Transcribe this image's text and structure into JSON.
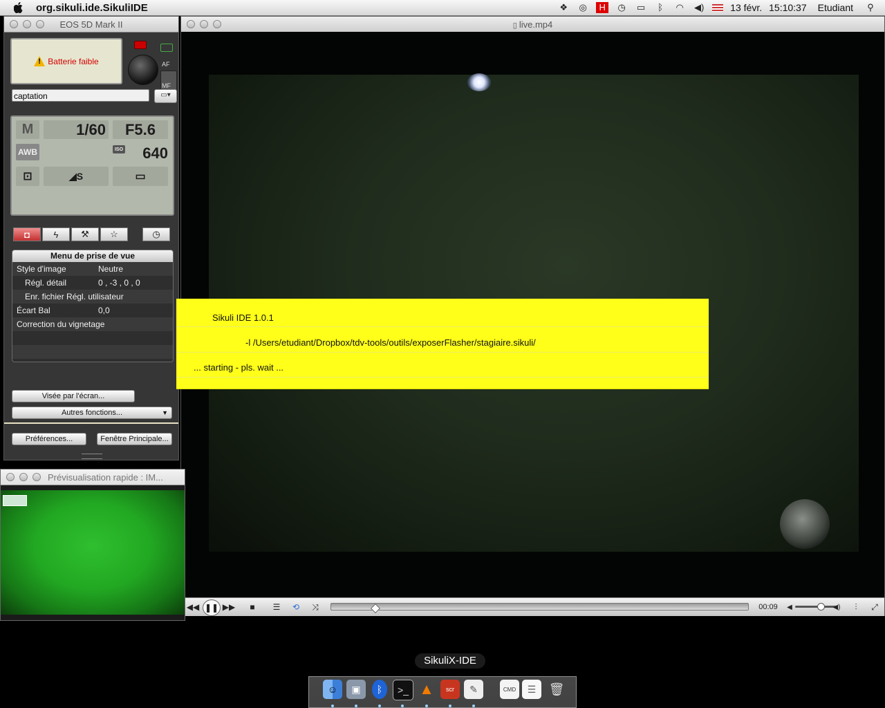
{
  "menubar": {
    "app_name": "org.sikuli.ide.SikuliIDE",
    "date": "13 févr.",
    "time": "15:10:37",
    "user": "Etudiant",
    "icons": [
      "dropbox-icon",
      "cc-icon",
      "flag-icon",
      "time-machine-icon",
      "display-icon",
      "bluetooth-icon",
      "wifi-icon",
      "volume-icon",
      "us-flag-icon",
      "spotlight-icon"
    ]
  },
  "eos_window": {
    "title": "EOS 5D Mark II",
    "battery_warning": "Batterie faible",
    "af_label": "AF",
    "mf_label": "MF",
    "folder_name": "captation",
    "lcd": {
      "mode": "M",
      "shutter": "1/60",
      "aperture": "F5.6",
      "wb": "AWB",
      "iso_label": "ISO",
      "iso": "640",
      "quality": "◢S"
    },
    "menu": {
      "header": "Menu de prise de vue",
      "rows": [
        {
          "label": "Style d'image",
          "value": "Neutre",
          "indent": false
        },
        {
          "label": "Régl. détail",
          "value": "0 , -3 , 0 , 0",
          "indent": true
        },
        {
          "label": "Enr. fichier Régl. utilisateur",
          "value": "",
          "indent": true
        },
        {
          "label": "Écart Bal",
          "value": "0,0",
          "indent": false
        },
        {
          "label": "Correction du vignetage",
          "value": "",
          "indent": false
        }
      ]
    },
    "live_view_button": "Visée par l'écran...",
    "other_functions_button": "Autres fonctions...",
    "preferences_button": "Préférences...",
    "main_window_button": "Fenêtre Principale..."
  },
  "preview_window": {
    "title": "Prévisualisation rapide : IM..."
  },
  "player": {
    "title": "live.mp4",
    "time": "00:09",
    "seek_fraction": 0.1
  },
  "splash": {
    "line1": "Sikuli IDE 1.0.1",
    "line2": "-l /Users/etudiant/Dropbox/tdv-tools/outils/exposerFlasher/stagiaire.sikuli/",
    "line3": "... starting - pls. wait ..."
  },
  "dock": {
    "tooltip": "SikuliX-IDE",
    "items": [
      "finder-icon",
      "remote-desktop-icon",
      "bluetooth-icon",
      "terminal-icon",
      "vlc-icon",
      "applescript-icon",
      "script-editor-icon",
      "document-icon",
      "preview-document-icon",
      "trash-icon"
    ]
  },
  "colors": {
    "splash_yellow": "#ffff1a",
    "warning_red": "#d20000",
    "active_tab": "#c23030"
  }
}
